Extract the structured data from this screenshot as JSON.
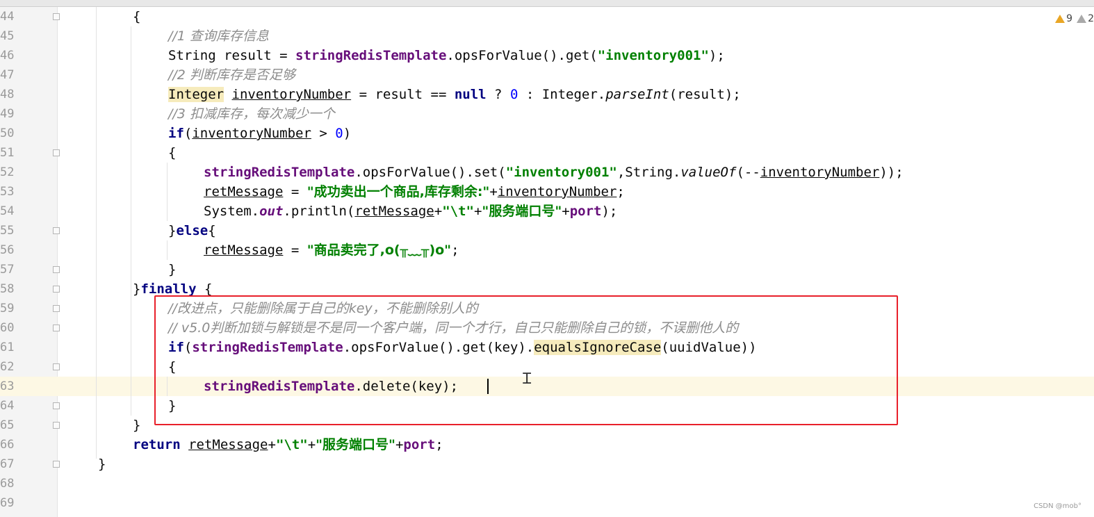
{
  "editor": {
    "line_numbers": [
      "44",
      "45",
      "46",
      "47",
      "48",
      "49",
      "50",
      "51",
      "52",
      "53",
      "54",
      "55",
      "56",
      "57",
      "58",
      "59",
      "60",
      "61",
      "62",
      "63",
      "64",
      "65",
      "66",
      "67",
      "68",
      "69"
    ],
    "inspections": {
      "warnings": "9",
      "weak_warnings": "2"
    },
    "watermark": "CSDN @mob°",
    "lines": {
      "l44": {
        "brace": "{"
      },
      "l45": {
        "comment": "//1 查询库存信息"
      },
      "l46": {
        "type": "String ",
        "var": "result",
        "assign": " = ",
        "field": "stringRedisTemplate",
        "call": ".opsForValue().get(",
        "str": "\"inventory001\"",
        "end": ");"
      },
      "l47": {
        "comment": "//2 判断库存是否足够"
      },
      "l48": {
        "type": "Integer",
        "sp": " ",
        "var": "inventoryNumber",
        "mid": " = result == ",
        "kw_null": "null",
        "q": " ? ",
        "zero": "0",
        "colon": " : Integer.",
        "method": "parseInt",
        "end": "(result);"
      },
      "l49": {
        "comment": "//3 扣减库存，每次减少一个"
      },
      "l50": {
        "kw": "if",
        "open": "(",
        "var": "inventoryNumber",
        "mid": " > ",
        "zero": "0",
        "close": ")"
      },
      "l51": {
        "brace": "{"
      },
      "l52": {
        "field": "stringRedisTemplate",
        "call": ".opsForValue().set(",
        "str": "\"inventory001\"",
        "mid": ",String.",
        "method": "valueOf",
        "pre": "(--",
        "var": "inventoryNumber",
        "end": "));"
      },
      "l53": {
        "var": "retMessage",
        "assign": " = ",
        "str": "\"成功卖出一个商品,库存剩余:\"",
        "plus": "+",
        "var2": "inventoryNumber",
        "end": ";"
      },
      "l54": {
        "pre": "System.",
        "static_field": "out",
        "call": ".println(",
        "var": "retMessage",
        "plus1": "+",
        "str1": "\"\\t\"",
        "plus2": "+",
        "str2": "\"服务端口号\"",
        "plus3": "+",
        "field": "port",
        "end": ");"
      },
      "l55": {
        "brace": "}",
        "kw": "else",
        "brace2": "{"
      },
      "l56": {
        "var": "retMessage",
        "assign": " = ",
        "str": "\"商品卖完了,o(╥﹏╥)o\"",
        "end": ";"
      },
      "l57": {
        "brace": "}"
      },
      "l58": {
        "brace": "}",
        "kw": "finally",
        "brace2": " {"
      },
      "l59": {
        "comment": "//改进点，只能删除属于自己的key，不能删除别人的"
      },
      "l60": {
        "comment": "// v5.0判断加锁与解锁是不是同一个客户端，同一个才行，自己只能删除自己的锁，不误删他人的"
      },
      "l61": {
        "kw": "if",
        "open": "(",
        "field": "stringRedisTemplate",
        "call": ".opsForValue().get(key).",
        "method": "equalsIgnoreCase",
        "end": "(uuidValue))"
      },
      "l62": {
        "brace": "{"
      },
      "l63": {
        "field": "stringRedisTemplate",
        "call": ".delete(key);"
      },
      "l64": {
        "brace": "}"
      },
      "l65": {
        "brace": "}"
      },
      "l66": {
        "kw": "return",
        "sp": " ",
        "var": "retMessage",
        "plus1": "+",
        "str1": "\"\\t\"",
        "plus2": "+",
        "str2": "\"服务端口号\"",
        "plus3": "+",
        "field": "port",
        "end": ";"
      },
      "l67": {
        "brace": "}"
      }
    }
  }
}
